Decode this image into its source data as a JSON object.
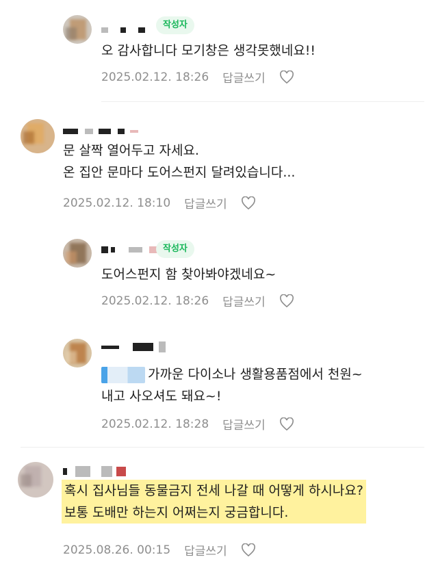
{
  "comments": [
    {
      "badge": "작성자",
      "lines": [
        "오 감사합니다 모기창은 생각못했네요!!"
      ],
      "date": "2025.02.12. 18:26",
      "reply": "답글쓰기"
    },
    {
      "lines": [
        "문 살짝 열어두고 자세요.",
        "온 집안 문마다 도어스펀지 달려있습니다..."
      ],
      "date": "2025.02.12. 18:10",
      "reply": "답글쓰기"
    },
    {
      "badge": "작성자",
      "lines": [
        "도어스펀지 함 찾아봐야겠네요~"
      ],
      "date": "2025.02.12. 18:26",
      "reply": "답글쓰기"
    },
    {
      "lines": [
        "가까운 다이소나 생활용품점에서 천원~",
        "내고 사오셔도 돼요~!"
      ],
      "date": "2025.02.12. 18:28",
      "reply": "답글쓰기"
    },
    {
      "lines": [
        "혹시 집사님들 동물금지 전세 나갈 때 어떻게 하시나요?",
        "보통 도배만 하는지 어쩌는지 궁금합니다."
      ],
      "date": "2025.08.26. 00:15",
      "reply": "답글쓰기"
    }
  ],
  "icons": {
    "like": "heart-outline-icon"
  },
  "colors": {
    "badge_text": "#19b75a",
    "badge_bg": "#e9f8ee",
    "highlight": "#fff29e",
    "meta": "#8e8e8e"
  }
}
